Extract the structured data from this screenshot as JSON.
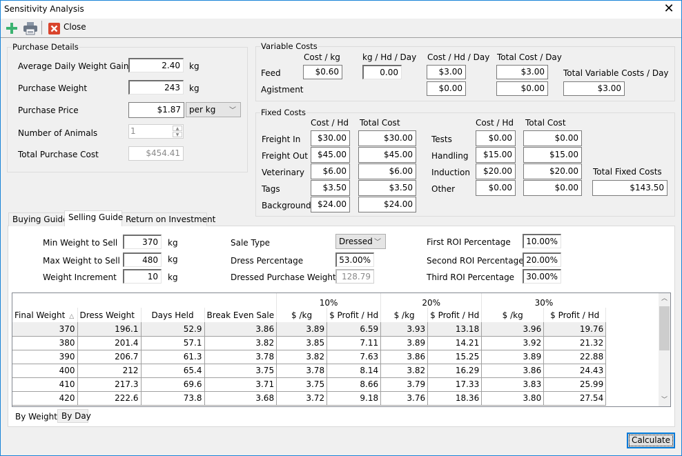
{
  "window": {
    "title": "Sensitivity Analysis",
    "close_glyph": "✕"
  },
  "toolbar": {
    "add_icon": "plus-icon",
    "print_icon": "printer-icon",
    "close_icon": "close-red-icon",
    "close_label": "Close"
  },
  "purchase_details": {
    "legend": "Purchase Details",
    "adwg": {
      "label": "Average Daily Weight Gain",
      "value": "2.40",
      "unit": "kg"
    },
    "purchase_weight": {
      "label": "Purchase Weight",
      "value": "243",
      "unit": "kg"
    },
    "purchase_price": {
      "label": "Purchase Price",
      "value": "$1.87",
      "unit_option": "per kg"
    },
    "number_of_animals": {
      "label": "Number of Animals",
      "value": "1"
    },
    "total_purchase_cost": {
      "label": "Total Purchase Cost",
      "value": "$454.41"
    }
  },
  "variable_costs": {
    "legend": "Variable Costs",
    "headers": {
      "cost_kg": "Cost / kg",
      "kg_hd_day": "kg / Hd / Day",
      "cost_hd_day": "Cost / Hd / Day",
      "total_cost_day": "Total Cost / Day"
    },
    "feed": {
      "label": "Feed",
      "cost_kg": "$0.60",
      "kg_hd_day": "0.00",
      "cost_hd_day": "$3.00",
      "total_cost_day": "$3.00"
    },
    "agistment": {
      "label": "Agistment",
      "cost_hd_day": "$0.00",
      "total_cost_day": "$0.00"
    },
    "total": {
      "label": "Total Variable Costs / Day",
      "value": "$3.00"
    }
  },
  "fixed_costs": {
    "legend": "Fixed Costs",
    "headers": {
      "cost_hd": "Cost / Hd",
      "total_cost": "Total Cost"
    },
    "left": [
      {
        "label": "Freight In",
        "cost_hd": "$30.00",
        "total": "$30.00"
      },
      {
        "label": "Freight Out",
        "cost_hd": "$45.00",
        "total": "$45.00"
      },
      {
        "label": "Veterinary",
        "cost_hd": "$6.00",
        "total": "$6.00"
      },
      {
        "label": "Tags",
        "cost_hd": "$3.50",
        "total": "$3.50"
      },
      {
        "label": "Background",
        "cost_hd": "$24.00",
        "total": "$24.00"
      }
    ],
    "right": [
      {
        "label": "Tests",
        "cost_hd": "$0.00",
        "total": "$0.00"
      },
      {
        "label": "Handling",
        "cost_hd": "$15.00",
        "total": "$15.00"
      },
      {
        "label": "Induction",
        "cost_hd": "$20.00",
        "total": "$20.00"
      },
      {
        "label": "Other",
        "cost_hd": "$0.00",
        "total": "$0.00"
      }
    ],
    "total": {
      "label": "Total Fixed Costs",
      "value": "$143.50"
    }
  },
  "tabs": [
    {
      "label": "Buying Guide",
      "active": false
    },
    {
      "label": "Selling Guide",
      "active": true
    },
    {
      "label": "Return on Investment",
      "active": false
    }
  ],
  "selling_guide": {
    "min_weight": {
      "label": "Min Weight to Sell",
      "value": "370",
      "unit": "kg"
    },
    "max_weight": {
      "label": "Max Weight to Sell",
      "value": "480",
      "unit": "kg"
    },
    "weight_increment": {
      "label": "Weight Increment",
      "value": "10",
      "unit": "kg"
    },
    "sale_type": {
      "label": "Sale Type",
      "value": "Dressed"
    },
    "dress_percentage": {
      "label": "Dress Percentage",
      "value": "53.00%"
    },
    "dressed_purchase_weight": {
      "label": "Dressed Purchase Weight",
      "value": "128.79"
    },
    "first_roi": {
      "label": "First ROI Percentage",
      "value": "10.00%"
    },
    "second_roi": {
      "label": "Second ROI Percentage",
      "value": "20.00%"
    },
    "third_roi": {
      "label": "Third ROI Percentage",
      "value": "30.00%"
    }
  },
  "grid": {
    "groups": [
      "10%",
      "20%",
      "30%"
    ],
    "columns": [
      "Final Weight",
      "Dress Weight",
      "Days Held",
      "Break Even Sale",
      "$ /kg",
      "$ Profit / Hd",
      "$ /kg",
      "$ Profit / Hd",
      "$ /kg",
      "$ Profit / Hd"
    ],
    "sort_indicator": "△",
    "rows": [
      [
        "370",
        "196.1",
        "52.9",
        "3.86",
        "3.89",
        "6.59",
        "3.93",
        "13.18",
        "3.96",
        "19.76"
      ],
      [
        "380",
        "201.4",
        "57.1",
        "3.82",
        "3.85",
        "7.11",
        "3.89",
        "14.21",
        "3.92",
        "21.32"
      ],
      [
        "390",
        "206.7",
        "61.3",
        "3.78",
        "3.82",
        "7.63",
        "3.86",
        "15.25",
        "3.89",
        "22.88"
      ],
      [
        "400",
        "212",
        "65.4",
        "3.75",
        "3.78",
        "8.14",
        "3.82",
        "16.29",
        "3.86",
        "24.43"
      ],
      [
        "410",
        "217.3",
        "69.6",
        "3.71",
        "3.75",
        "8.66",
        "3.79",
        "17.33",
        "3.83",
        "25.99"
      ],
      [
        "420",
        "222.6",
        "73.8",
        "3.68",
        "3.72",
        "9.18",
        "3.76",
        "18.36",
        "3.80",
        "27.54"
      ]
    ],
    "selected_row": 0
  },
  "view_tabs": [
    {
      "label": "By Weight",
      "active": true
    },
    {
      "label": "By Day",
      "active": false
    }
  ],
  "calculate_label": "Calculate",
  "colors": {
    "accent": "#0078d7",
    "add_green": "#3cb371",
    "close_red": "#d9442c"
  }
}
